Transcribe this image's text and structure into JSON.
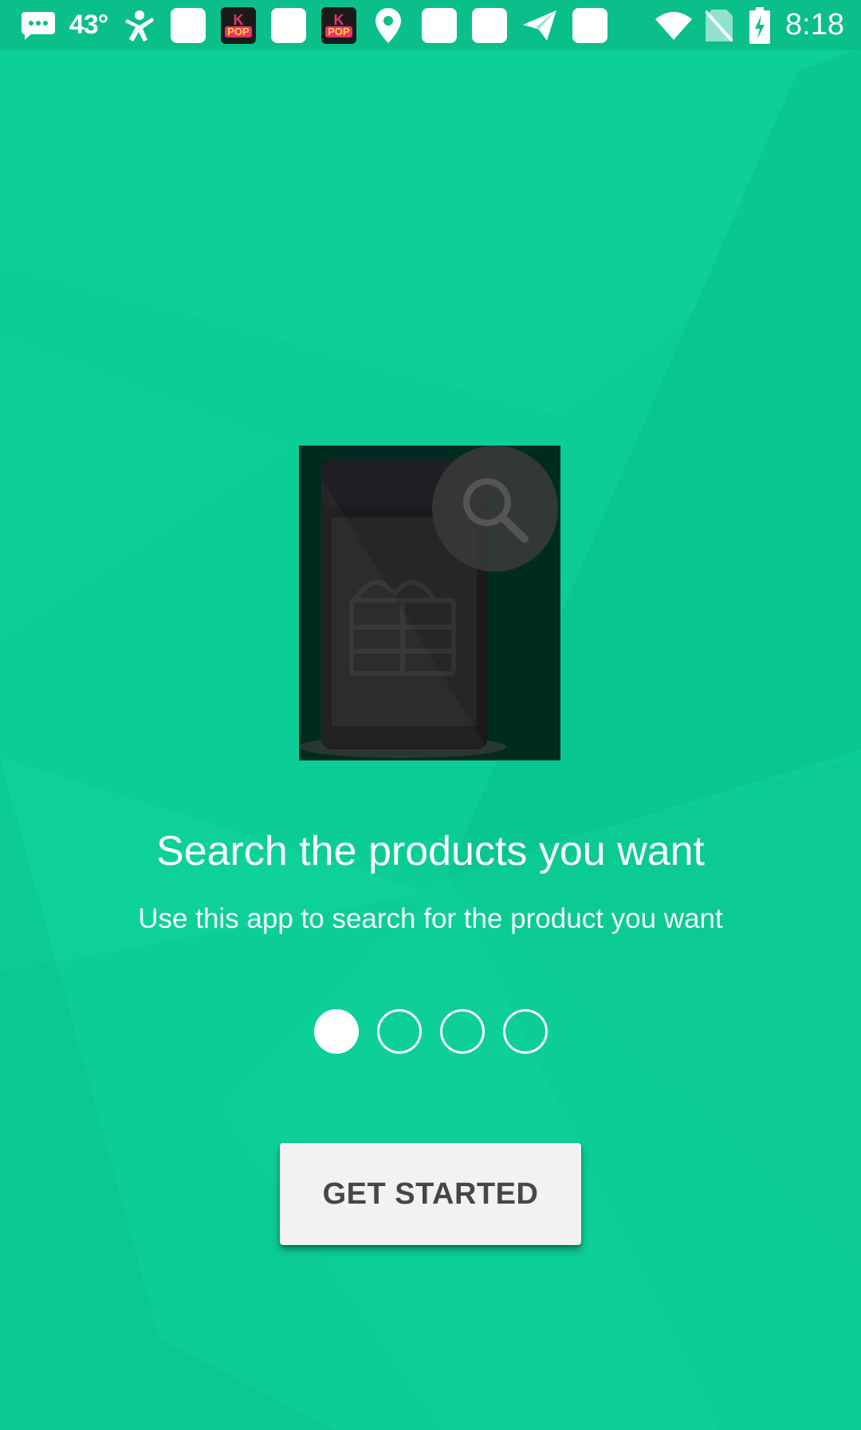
{
  "status_bar": {
    "temperature": "43°",
    "time": "8:18",
    "kpop_top": "K",
    "kpop_bottom": "POP"
  },
  "onboarding": {
    "title": "Search the products you want",
    "subtitle": "Use this app to search for the product you want",
    "pages": [
      {
        "active": true
      },
      {
        "active": false
      },
      {
        "active": false
      },
      {
        "active": false
      }
    ],
    "cta_label": "GET STARTED"
  },
  "colors": {
    "background": "#0ccd95",
    "status_bar": "#0bbf8a",
    "illustration_bg": "#002c20",
    "button_bg": "#f2f2f2",
    "button_text": "#464646"
  }
}
